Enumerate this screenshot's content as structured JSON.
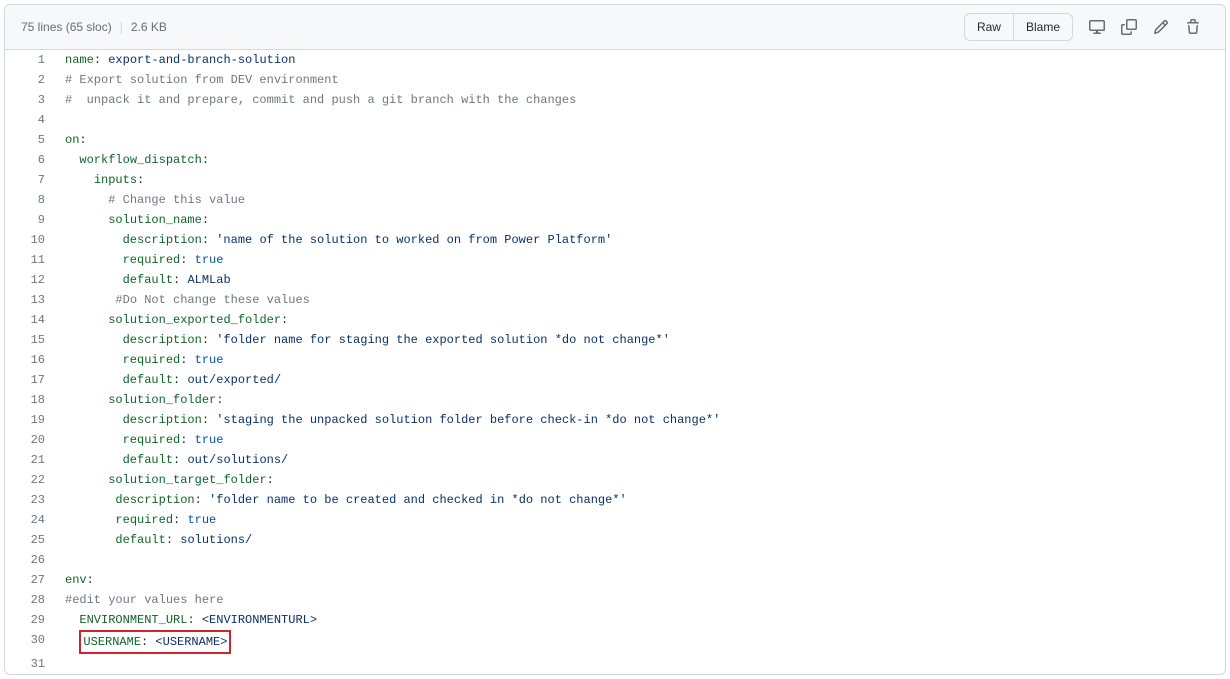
{
  "header": {
    "lines": "75 lines (65 sloc)",
    "size": "2.6 KB",
    "raw_label": "Raw",
    "blame_label": "Blame"
  },
  "code": [
    {
      "n": 1,
      "segments": [
        {
          "t": "ent",
          "v": "name"
        },
        {
          "t": "",
          "v": ": "
        },
        {
          "t": "s",
          "v": "export-and-branch-solution"
        }
      ]
    },
    {
      "n": 2,
      "segments": [
        {
          "t": "c",
          "v": "# Export solution from DEV environment"
        }
      ]
    },
    {
      "n": 3,
      "segments": [
        {
          "t": "c",
          "v": "#  unpack it and prepare, commit and push a git branch with the changes"
        }
      ]
    },
    {
      "n": 4,
      "segments": []
    },
    {
      "n": 5,
      "segments": [
        {
          "t": "ent",
          "v": "on"
        },
        {
          "t": "",
          "v": ":"
        }
      ]
    },
    {
      "n": 6,
      "segments": [
        {
          "t": "",
          "v": "  "
        },
        {
          "t": "ent",
          "v": "workflow_dispatch"
        },
        {
          "t": "",
          "v": ":"
        }
      ]
    },
    {
      "n": 7,
      "segments": [
        {
          "t": "",
          "v": "    "
        },
        {
          "t": "ent",
          "v": "inputs"
        },
        {
          "t": "",
          "v": ":"
        }
      ]
    },
    {
      "n": 8,
      "segments": [
        {
          "t": "",
          "v": "      "
        },
        {
          "t": "c",
          "v": "# Change this value"
        }
      ]
    },
    {
      "n": 9,
      "segments": [
        {
          "t": "",
          "v": "      "
        },
        {
          "t": "ent",
          "v": "solution_name"
        },
        {
          "t": "",
          "v": ":"
        }
      ]
    },
    {
      "n": 10,
      "segments": [
        {
          "t": "",
          "v": "        "
        },
        {
          "t": "ent",
          "v": "description"
        },
        {
          "t": "",
          "v": ": "
        },
        {
          "t": "s",
          "v": "'name of the solution to worked on from Power Platform'"
        }
      ]
    },
    {
      "n": 11,
      "segments": [
        {
          "t": "",
          "v": "        "
        },
        {
          "t": "ent",
          "v": "required"
        },
        {
          "t": "",
          "v": ": "
        },
        {
          "t": "c1",
          "v": "true"
        }
      ]
    },
    {
      "n": 12,
      "segments": [
        {
          "t": "",
          "v": "        "
        },
        {
          "t": "ent",
          "v": "default"
        },
        {
          "t": "",
          "v": ": "
        },
        {
          "t": "s",
          "v": "ALMLab"
        }
      ]
    },
    {
      "n": 13,
      "segments": [
        {
          "t": "",
          "v": "       "
        },
        {
          "t": "c",
          "v": "#Do Not change these values"
        }
      ]
    },
    {
      "n": 14,
      "segments": [
        {
          "t": "",
          "v": "      "
        },
        {
          "t": "ent",
          "v": "solution_exported_folder"
        },
        {
          "t": "",
          "v": ":"
        }
      ]
    },
    {
      "n": 15,
      "segments": [
        {
          "t": "",
          "v": "        "
        },
        {
          "t": "ent",
          "v": "description"
        },
        {
          "t": "",
          "v": ": "
        },
        {
          "t": "s",
          "v": "'folder name for staging the exported solution *do not change*'"
        }
      ]
    },
    {
      "n": 16,
      "segments": [
        {
          "t": "",
          "v": "        "
        },
        {
          "t": "ent",
          "v": "required"
        },
        {
          "t": "",
          "v": ": "
        },
        {
          "t": "c1",
          "v": "true"
        }
      ]
    },
    {
      "n": 17,
      "segments": [
        {
          "t": "",
          "v": "        "
        },
        {
          "t": "ent",
          "v": "default"
        },
        {
          "t": "",
          "v": ": "
        },
        {
          "t": "s",
          "v": "out/exported/"
        }
      ]
    },
    {
      "n": 18,
      "segments": [
        {
          "t": "",
          "v": "      "
        },
        {
          "t": "ent",
          "v": "solution_folder"
        },
        {
          "t": "",
          "v": ":"
        }
      ]
    },
    {
      "n": 19,
      "segments": [
        {
          "t": "",
          "v": "        "
        },
        {
          "t": "ent",
          "v": "description"
        },
        {
          "t": "",
          "v": ": "
        },
        {
          "t": "s",
          "v": "'staging the unpacked solution folder before check-in *do not change*'"
        }
      ]
    },
    {
      "n": 20,
      "segments": [
        {
          "t": "",
          "v": "        "
        },
        {
          "t": "ent",
          "v": "required"
        },
        {
          "t": "",
          "v": ": "
        },
        {
          "t": "c1",
          "v": "true"
        }
      ]
    },
    {
      "n": 21,
      "segments": [
        {
          "t": "",
          "v": "        "
        },
        {
          "t": "ent",
          "v": "default"
        },
        {
          "t": "",
          "v": ": "
        },
        {
          "t": "s",
          "v": "out/solutions/"
        }
      ]
    },
    {
      "n": 22,
      "segments": [
        {
          "t": "",
          "v": "      "
        },
        {
          "t": "ent",
          "v": "solution_target_folder"
        },
        {
          "t": "",
          "v": ":"
        }
      ]
    },
    {
      "n": 23,
      "segments": [
        {
          "t": "",
          "v": "       "
        },
        {
          "t": "ent",
          "v": "description"
        },
        {
          "t": "",
          "v": ": "
        },
        {
          "t": "s",
          "v": "'folder name to be created and checked in *do not change*'"
        }
      ]
    },
    {
      "n": 24,
      "segments": [
        {
          "t": "",
          "v": "       "
        },
        {
          "t": "ent",
          "v": "required"
        },
        {
          "t": "",
          "v": ": "
        },
        {
          "t": "c1",
          "v": "true"
        }
      ]
    },
    {
      "n": 25,
      "segments": [
        {
          "t": "",
          "v": "       "
        },
        {
          "t": "ent",
          "v": "default"
        },
        {
          "t": "",
          "v": ": "
        },
        {
          "t": "s",
          "v": "solutions/"
        }
      ]
    },
    {
      "n": 26,
      "segments": []
    },
    {
      "n": 27,
      "segments": [
        {
          "t": "ent",
          "v": "env"
        },
        {
          "t": "",
          "v": ":"
        }
      ]
    },
    {
      "n": 28,
      "segments": [
        {
          "t": "c",
          "v": "#edit your values here"
        }
      ]
    },
    {
      "n": 29,
      "segments": [
        {
          "t": "",
          "v": "  "
        },
        {
          "t": "ent",
          "v": "ENVIRONMENT_URL"
        },
        {
          "t": "",
          "v": ": "
        },
        {
          "t": "s",
          "v": "<ENVIRONMENTURL>"
        }
      ]
    },
    {
      "n": 30,
      "highlight": true,
      "segments": [
        {
          "t": "",
          "v": "  "
        },
        {
          "t": "ent",
          "v": "USERNAME"
        },
        {
          "t": "",
          "v": ": "
        },
        {
          "t": "s",
          "v": "<USERNAME>"
        }
      ]
    },
    {
      "n": 31,
      "segments": []
    }
  ]
}
